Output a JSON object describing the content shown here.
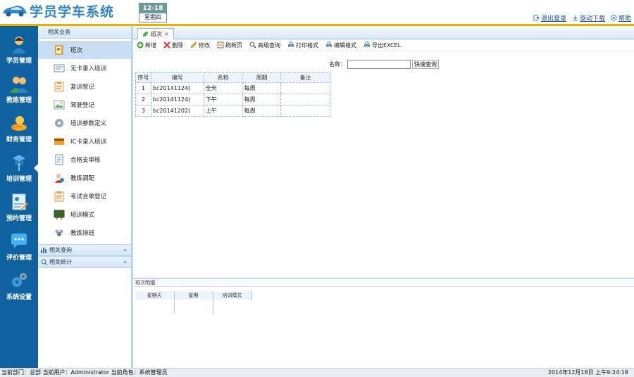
{
  "header": {
    "app_title": "学员学车系统",
    "date": "12-18",
    "weekday": "星期四",
    "links": {
      "logout": "退出登录",
      "driver_download": "驱动下载",
      "help": "帮助"
    }
  },
  "leftnav": [
    {
      "label": "学员管理",
      "icon": "student-icon"
    },
    {
      "label": "教练管理",
      "icon": "coach-icon"
    },
    {
      "label": "财务管理",
      "icon": "finance-icon"
    },
    {
      "label": "培训管理",
      "icon": "training-icon"
    },
    {
      "label": "预约管理",
      "icon": "booking-icon"
    },
    {
      "label": "评价管理",
      "icon": "evaluation-icon"
    },
    {
      "label": "系统设置",
      "icon": "settings-icon"
    }
  ],
  "submenu": {
    "head": "相关业务",
    "items": [
      "班次",
      "无卡录入培训",
      "复训登记",
      "驾驶登记",
      "培训参数定义",
      "IC卡录入培训",
      "合格支审核",
      "教练调配",
      "考试合单登记",
      "培训模式",
      "教练排班"
    ],
    "acc_query": "相关查询",
    "acc_stats": "相关统计"
  },
  "content": {
    "tab": "班次",
    "toolbar": [
      "新增",
      "删除",
      "修改",
      "刷新页",
      "高级查询",
      "打印格式",
      "编辑格式",
      "导出EXCEL"
    ],
    "search_label": "名称：",
    "search_value": "",
    "quick_search": "快速查询",
    "columns": [
      "序号",
      "编号",
      "名称",
      "周期",
      "备注"
    ],
    "rows": [
      {
        "no": "1",
        "code": "bc20141124(",
        "name": "全天",
        "period": "每周",
        "remark": ""
      },
      {
        "no": "2",
        "code": "bc20141124(",
        "name": "下午",
        "period": "每周",
        "remark": ""
      },
      {
        "no": "3",
        "code": "bc20141202(",
        "name": "上午",
        "period": "每周",
        "remark": ""
      }
    ],
    "detail_title": "班次明细",
    "detail_columns": [
      "星期天",
      "星期",
      "培训模式"
    ]
  },
  "statusbar": {
    "left": "当前部门：总部    当前用户：Administrator    当前角色：系统管理员",
    "right": "2014年12月18日 上午9:24:18"
  },
  "colors": {
    "nav_bg": "#10619f",
    "accent_gold": "#e2b300",
    "title_blue": "#3186c6"
  }
}
